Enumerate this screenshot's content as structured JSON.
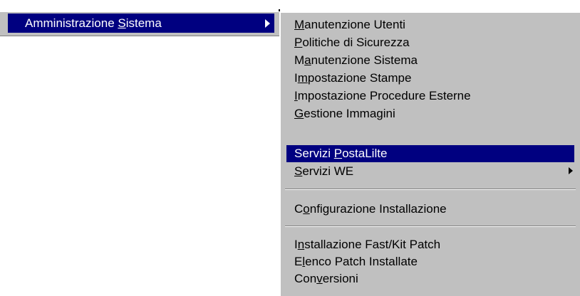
{
  "parent_menu": {
    "item": {
      "label_before": "Amministrazione ",
      "label_mnemonic": "S",
      "label_after": "istema",
      "has_submenu": true
    }
  },
  "submenu": {
    "items": [
      {
        "pre": "",
        "mn": "M",
        "post": "anutenzione Utenti"
      },
      {
        "pre": "",
        "mn": "P",
        "post": "olitiche di Sicurezza"
      },
      {
        "pre": "M",
        "mn": "a",
        "post": "nutenzione Sistema"
      },
      {
        "pre": "I",
        "mn": "m",
        "post": "postazione Stampe"
      },
      {
        "pre": "",
        "mn": "I",
        "post": "mpostazione Procedure Esterne"
      },
      {
        "pre": "",
        "mn": "G",
        "post": "estione Immagini"
      },
      {
        "pre": "Servizi ",
        "mn": "P",
        "post": "ostaLilte",
        "selected": true
      },
      {
        "pre": "",
        "mn": "S",
        "post": "ervizi WE",
        "has_submenu": true
      },
      {
        "pre": "C",
        "mn": "o",
        "post": "nfigurazione Installazione"
      },
      {
        "pre": "I",
        "mn": "n",
        "post": "stallazione Fast/Kit Patch"
      },
      {
        "pre": "E",
        "mn": "l",
        "post": "enco Patch Installate"
      },
      {
        "pre": "Con",
        "mn": "v",
        "post": "ersioni"
      }
    ]
  },
  "colors": {
    "menu_face": "#c0c0c0",
    "highlight": "#000080",
    "highlight_text": "#ffffff",
    "shadow": "#808080"
  }
}
